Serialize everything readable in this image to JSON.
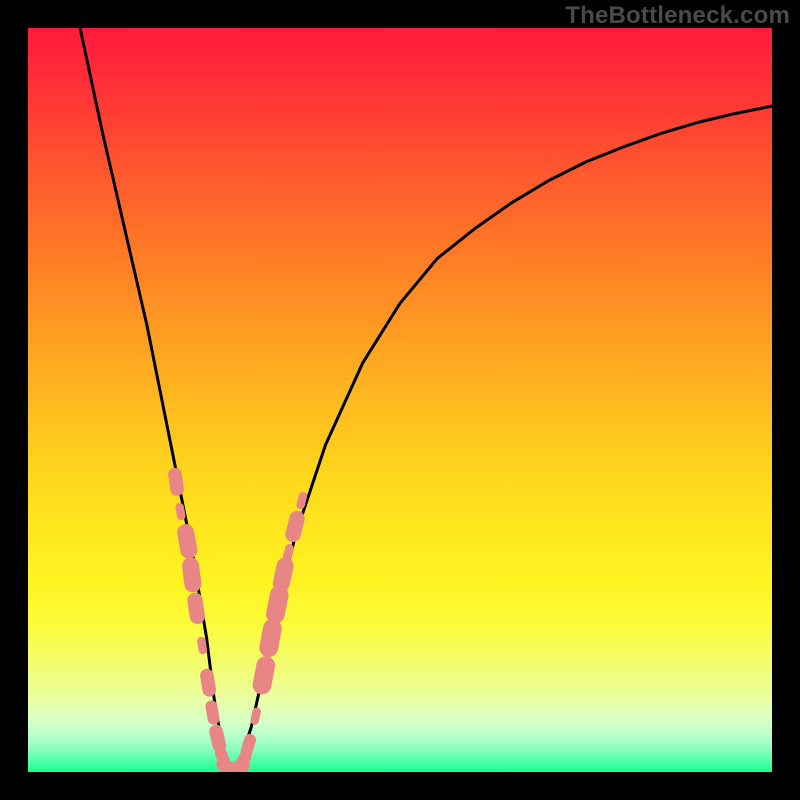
{
  "watermark": "TheBottleneck.com",
  "chart_data": {
    "type": "line",
    "title": "",
    "xlabel": "",
    "ylabel": "",
    "xlim": [
      0,
      100
    ],
    "ylim": [
      0,
      100
    ],
    "grid": false,
    "legend": false,
    "annotations": [],
    "series": [
      {
        "name": "bottleneck-curve",
        "stroke": "#000000",
        "x": [
          7,
          10,
          13,
          16,
          18,
          20,
          22,
          24,
          25,
          26,
          27,
          28,
          30,
          32,
          34,
          36,
          40,
          45,
          50,
          55,
          60,
          65,
          70,
          75,
          80,
          85,
          90,
          95,
          100
        ],
        "y": [
          100,
          86,
          73,
          60,
          50,
          40,
          30,
          18,
          10,
          4,
          0,
          0,
          6,
          15,
          24,
          32,
          44,
          55,
          63,
          69,
          73,
          76.5,
          79.5,
          82,
          84,
          85.8,
          87.3,
          88.5,
          89.5
        ]
      }
    ],
    "markers": [
      {
        "name": "data-points",
        "shape": "pill",
        "fill": "#e88585",
        "points": [
          {
            "x": 19.9,
            "y": 39.0,
            "r": 8
          },
          {
            "x": 20.5,
            "y": 35.0,
            "r": 5
          },
          {
            "x": 21.4,
            "y": 31.0,
            "r": 10
          },
          {
            "x": 22.0,
            "y": 26.5,
            "r": 10
          },
          {
            "x": 22.6,
            "y": 22.0,
            "r": 9
          },
          {
            "x": 23.4,
            "y": 17.0,
            "r": 5
          },
          {
            "x": 24.2,
            "y": 12.0,
            "r": 8
          },
          {
            "x": 24.8,
            "y": 8.0,
            "r": 7
          },
          {
            "x": 25.5,
            "y": 4.5,
            "r": 8
          },
          {
            "x": 26.2,
            "y": 1.8,
            "r": 7
          },
          {
            "x": 27.0,
            "y": 0.5,
            "r": 8
          },
          {
            "x": 28.0,
            "y": 0.5,
            "r": 8
          },
          {
            "x": 28.8,
            "y": 1.3,
            "r": 7
          },
          {
            "x": 29.6,
            "y": 3.5,
            "r": 7
          },
          {
            "x": 30.6,
            "y": 7.5,
            "r": 5
          },
          {
            "x": 31.7,
            "y": 13.0,
            "r": 11
          },
          {
            "x": 32.6,
            "y": 18.0,
            "r": 11
          },
          {
            "x": 33.5,
            "y": 22.5,
            "r": 11
          },
          {
            "x": 34.3,
            "y": 26.5,
            "r": 10
          },
          {
            "x": 35.0,
            "y": 29.5,
            "r": 5
          },
          {
            "x": 35.9,
            "y": 33.0,
            "r": 9
          },
          {
            "x": 36.8,
            "y": 36.5,
            "r": 5
          }
        ]
      }
    ],
    "background_gradient": {
      "top": "#ff1a3d",
      "mid": "#ffe81e",
      "bottom": "#17ff8f"
    }
  }
}
